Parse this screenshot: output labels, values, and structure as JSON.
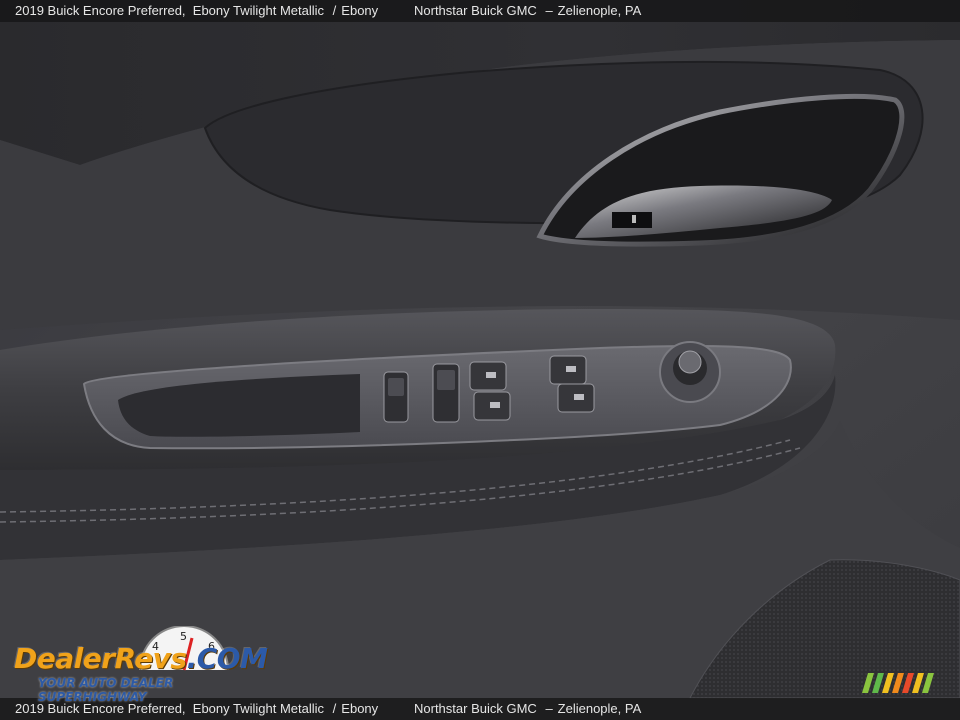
{
  "caption": {
    "vehicle": "2019 Buick Encore Preferred,",
    "color": "Ebony Twilight Metallic",
    "separator": "/",
    "interior": "Ebony",
    "dealer": "Northstar Buick GMC",
    "dash": "–",
    "location": "Zelienople, PA"
  },
  "watermark": {
    "brand_part1": "DealerRevs",
    "brand_part2": ".COM",
    "tagline": "YOUR AUTO DEALER SUPERHIGHWAY",
    "gauge_digits": [
      "4",
      "5",
      "6"
    ]
  },
  "colors": {
    "door_panel": "#3d3d40",
    "upper_trim": "#262628",
    "brand_orange": "#f0a21a",
    "brand_blue": "#2c5aa8"
  }
}
